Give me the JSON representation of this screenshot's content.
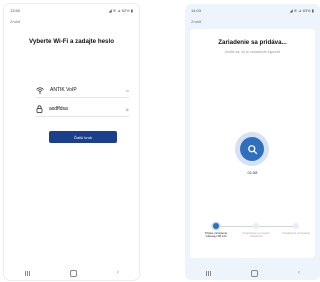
{
  "screen1": {
    "status_time": "13:50",
    "status_right": "◢ ≋ ⊿ 82% ▮",
    "back_label": "Zrušiť",
    "title": "Vyberte Wi-Fi a zadajte heslo",
    "wifi_name": "ANTIK VoIP",
    "wifi_action": "⇆",
    "password": "asdffdsa",
    "password_action": "◉",
    "next_button": "Ďalší krok",
    "icons": [
      "wifi-icon",
      "lock-icon",
      "swap-icon",
      "eye-icon"
    ]
  },
  "screen2": {
    "status_time": "14:03",
    "status_right": "◢ ≋ ⊿ 83% ▮",
    "back_label": "Zrušiť",
    "title": "Zariadenie sa pridáva...",
    "subtitle": "Uistite sa, že je zariadenie zapnuté",
    "timer": "01:58",
    "steps": [
      {
        "label": "Prijatie zariadenia Gateway-5B 143",
        "active": true
      },
      {
        "label": "Registrácia na cloude zariadenia",
        "active": false
      },
      {
        "label": "Inicializácia zariadenia",
        "active": false
      }
    ],
    "accent_color": "#2f6fbe"
  },
  "navbar": {
    "back_glyph": "‹"
  },
  "colors": {
    "button": "#1c3f8c",
    "accent": "#2f6fbe",
    "screen2_bg": "#eef4fb"
  }
}
